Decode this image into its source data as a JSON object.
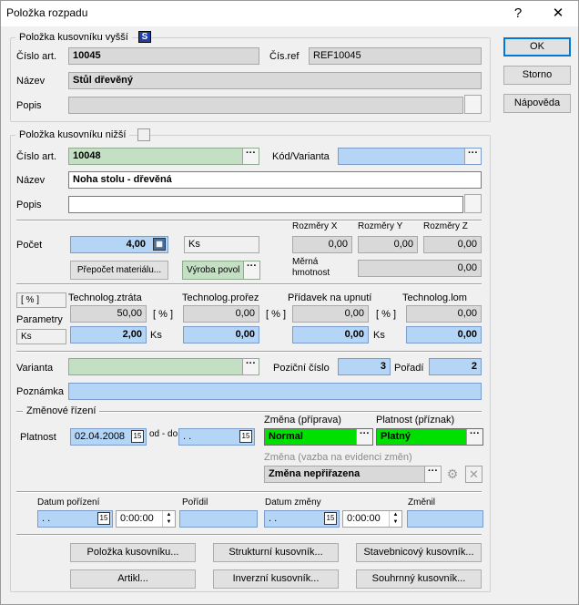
{
  "window": {
    "title": "Položka rozpadu",
    "help": "?",
    "close": "✕"
  },
  "upper": {
    "legend": "Položka kusovníku vyšší",
    "s_icon": "S",
    "cislo_label": "Číslo art.",
    "cislo": "10045",
    "cisref_label": "Čís.ref",
    "cisref": "REF10045",
    "nazev_label": "Název",
    "nazev": "Stůl dřevěný",
    "popis_label": "Popis"
  },
  "lower": {
    "legend": "Položka kusovníku nižší",
    "cislo_label": "Číslo art.",
    "cislo": "10048",
    "kod_label": "Kód/Varianta",
    "nazev_label": "Název",
    "nazev": "Noha stolu - dřevěná",
    "popis_label": "Popis"
  },
  "qty": {
    "pocet_label": "Počet",
    "pocet": "4,00",
    "unit": "Ks",
    "x_label": "Rozměry X",
    "y_label": "Rozměry Y",
    "z_label": "Rozměry Z",
    "x": "0,00",
    "y": "0,00",
    "z": "0,00",
    "prepocet_btn": "Přepočet materiálu...",
    "vyroba": "Výroba povol",
    "merna_label1": "Měrná",
    "merna_label2": "hmotnost",
    "merna": "0,00"
  },
  "params": {
    "pct_tag": "[ % ]",
    "param_label": "Parametry",
    "ks_tag": "Ks",
    "ztrata_label": "Technolog.ztráta",
    "prorez_label": "Technolog.prořez",
    "pridavek_label": "Přídavek na upnutí",
    "lom_label": "Technolog.lom",
    "pct": "[ % ]",
    "ks": "Ks",
    "ztrata_pct": "50,00",
    "ztrata_ks": "2,00",
    "prorez_pct": "0,00",
    "prorez_ks": "0,00",
    "pridavek_pct": "0,00",
    "pridavek_ks": "0,00",
    "lom_pct": "0,00",
    "lom_ks": "0,00"
  },
  "misc": {
    "varianta_label": "Varianta",
    "pozicni_label": "Poziční číslo",
    "pozicni": "3",
    "poradi_label": "Pořadí",
    "poradi": "2",
    "poznamka_label": "Poznámka"
  },
  "change": {
    "legend": "Změnové řízení",
    "platnost_label": "Platnost",
    "date_from": "02.04.2008",
    "od_do": "od - do",
    "date_to": ". .",
    "zmena_label": "Změna (příprava)",
    "zmena": "Normal",
    "platnost_priz_label": "Platnost (příznak)",
    "platnost_priz": "Platný",
    "vazba_label": "Změna (vazba na evidenci změn)",
    "vazba": "Změna nepřiřazena",
    "cal": "15"
  },
  "bottom": {
    "datum_por_label": "Datum pořízení",
    "datum_por": ". .",
    "cas_por": "0:00:00",
    "poridil_label": "Pořídil",
    "datum_zm_label": "Datum změny",
    "datum_zm": ". .",
    "cas_zm": "0:00:00",
    "zmenil_label": "Změnil"
  },
  "buttons": {
    "ok": "OK",
    "storno": "Storno",
    "napoveda": "Nápověda",
    "polozka": "Položka kusovníku...",
    "strukturni": "Strukturní kusovník...",
    "stavebnicovy": "Stavebnicový kusovník...",
    "artikl": "Artikl...",
    "inverzni": "Inverzní kusovník...",
    "souhrnny": "Souhrnný kusovník..."
  }
}
